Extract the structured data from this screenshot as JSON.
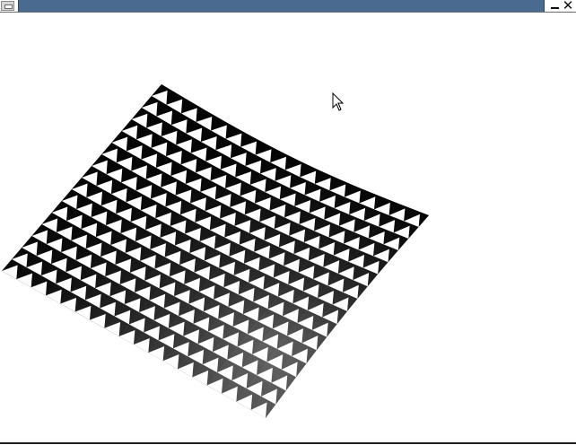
{
  "window": {
    "title": "",
    "controls": {
      "minimize_icon": "minimize-icon",
      "close_icon": "close-icon",
      "menu_icon": "window-menu-icon"
    }
  },
  "scene": {
    "description_icon": "textured-surface",
    "background": "#ffffff",
    "grid_rows": 16,
    "grid_cols": 18
  },
  "cursor": {
    "icon": "mouse-pointer-icon"
  },
  "colors": {
    "titlebar": "#4b6a8f",
    "surface_dark": "#1a1a1a",
    "surface_mid": "#5a5a5a",
    "surface_light": "#e8e8e8"
  }
}
